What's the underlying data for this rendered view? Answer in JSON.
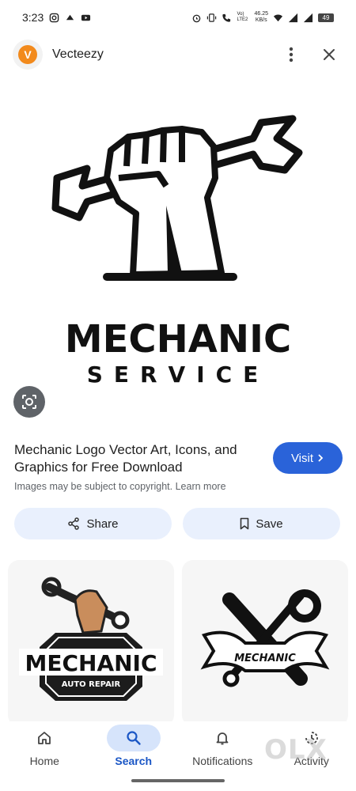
{
  "status_bar": {
    "time": "3:23",
    "net_speed_value": "46.25",
    "net_speed_unit": "KB/s",
    "volte": "Vo) LTE2",
    "battery": "49"
  },
  "header": {
    "site_name": "Vecteezy",
    "logo_letter": "V"
  },
  "preview": {
    "logo_text_main": "MECHANIC",
    "logo_text_sub": "SERVICE"
  },
  "result": {
    "title": "Mechanic Logo Vector Art, Icons, and Graphics for Free Download",
    "visit_label": "Visit",
    "note": "Images may be subject to copyright.",
    "learn_more": "Learn more",
    "share_label": "Share",
    "save_label": "Save"
  },
  "related": [
    {
      "main": "MECHANIC",
      "sub": "AUTO REPAIR"
    },
    {
      "main": "MECHANIC"
    }
  ],
  "bottom_nav": {
    "items": [
      {
        "label": "Home",
        "icon": "home-icon"
      },
      {
        "label": "Search",
        "icon": "search-icon",
        "active": true
      },
      {
        "label": "Notifications",
        "icon": "bell-icon"
      },
      {
        "label": "Activity",
        "icon": "history-icon"
      }
    ]
  },
  "watermark": "OLX",
  "colors": {
    "accent": "#2a63d9",
    "action_bg": "#e9f0fd",
    "nav_active_pill": "#d6e4fb",
    "brand_orange": "#f28a1c"
  }
}
